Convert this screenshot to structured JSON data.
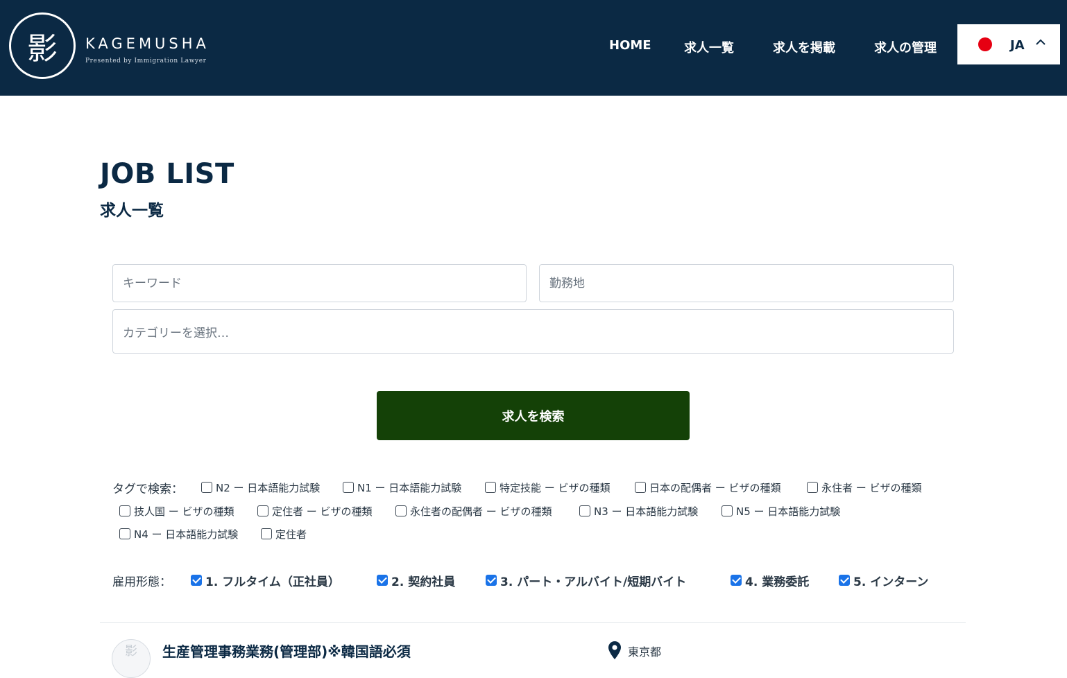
{
  "header": {
    "logo_kanji": "影",
    "logo_word": "KAGEMUSHA",
    "logo_tagline": "Presented by Immigration Lawyer",
    "nav": [
      "HOME",
      "求人一覧",
      "求人を掲載",
      "求人の管理"
    ],
    "language": {
      "code": "JA",
      "flag_color": "#e60012"
    }
  },
  "page": {
    "title_en": "JOB LIST",
    "title_ja": "求人一覧"
  },
  "search": {
    "keyword_placeholder": "キーワード",
    "location_placeholder": "勤務地",
    "category_placeholder": "カテゴリーを選択…",
    "button_label": "求人を検索",
    "button_color": "#144107"
  },
  "tags": {
    "label": "タグで検索：",
    "items": [
      {
        "label": "N2 ー 日本語能力試験",
        "checked": false
      },
      {
        "label": "N1 ー 日本語能力試験",
        "checked": false
      },
      {
        "label": "特定技能 ー ビザの種類",
        "checked": false
      },
      {
        "label": "日本の配偶者 ー ビザの種類",
        "checked": false
      },
      {
        "label": "永住者 ー ビザの種類",
        "checked": false
      },
      {
        "label": "技人国 ー ビザの種類",
        "checked": false
      },
      {
        "label": "定住者 ー ビザの種類",
        "checked": false
      },
      {
        "label": "永住者の配偶者 ー ビザの種類",
        "checked": false
      },
      {
        "label": "N3 ー 日本語能力試験",
        "checked": false
      },
      {
        "label": "N5 ー 日本語能力試験",
        "checked": false
      },
      {
        "label": "N4 ー 日本語能力試験",
        "checked": false
      },
      {
        "label": "定住者",
        "checked": false
      }
    ]
  },
  "employment": {
    "label": "雇用形態：",
    "items": [
      {
        "label": "1. フルタイム（正社員）",
        "checked": true
      },
      {
        "label": "2. 契約社員",
        "checked": true
      },
      {
        "label": "3. パート・アルバイト/短期バイト",
        "checked": true
      },
      {
        "label": "4. 業務委託",
        "checked": true
      },
      {
        "label": "5. インターン",
        "checked": true
      }
    ]
  },
  "jobs": [
    {
      "title": "生産管理事務業務(管理部)※韓国語必須",
      "location": "東京都",
      "avatar_text": "影"
    }
  ]
}
